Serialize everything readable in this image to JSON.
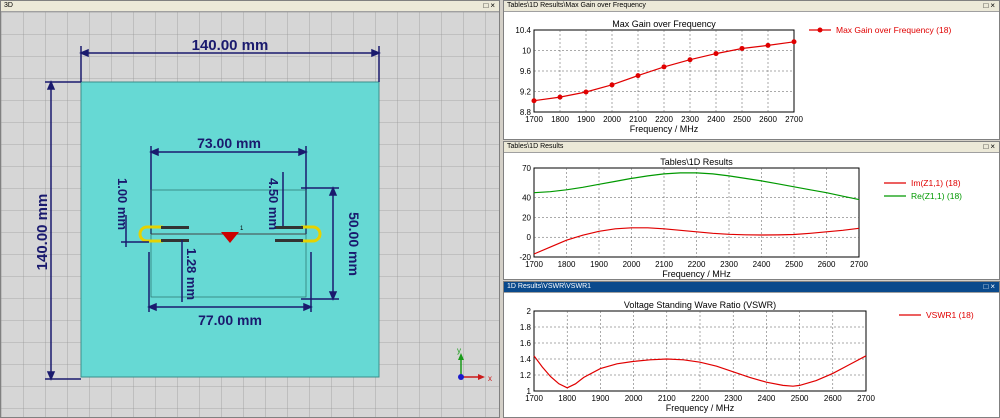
{
  "view3d": {
    "title": "3D",
    "dims": {
      "board_width": "140.00 mm",
      "board_height": "140.00 mm",
      "inner_width_top": "73.00 mm",
      "inner_width_bottom": "77.00 mm",
      "inner_height": "50.00 mm",
      "gap_left": "1.00 mm",
      "gap_right": "4.50 mm",
      "feed_gap": "1.28 mm"
    },
    "port_label": "1",
    "axes": {
      "x": "x",
      "y": "y"
    },
    "colors": {
      "substrate": "#66d9d4",
      "grid_bg": "#d8d8d8",
      "dim_line": "#1a1a6e",
      "port": "#cc0000",
      "arm": "#e6d200"
    }
  },
  "chart_data": [
    {
      "type": "line",
      "panel_title": "Tables\\1D Results\\Max Gain over Frequency",
      "title": "Max Gain over Frequency",
      "xlabel": "Frequency / MHz",
      "ylabel": "",
      "xlim": [
        1700,
        2700
      ],
      "ylim": [
        8.8,
        10.4
      ],
      "xticks": [
        1700,
        1800,
        1900,
        2000,
        2100,
        2200,
        2300,
        2400,
        2500,
        2600,
        2700
      ],
      "yticks": [
        8.8,
        9.2,
        9.6,
        10,
        10.4
      ],
      "yticklabels": [
        "8.8",
        "9.2",
        "9.6",
        "10",
        "10.4"
      ],
      "grid": true,
      "legend": "right",
      "series": [
        {
          "name": "Max Gain over Frequency (18)",
          "color": "#e00000",
          "markers": true,
          "x": [
            1700,
            1800,
            1900,
            2000,
            2100,
            2200,
            2300,
            2400,
            2500,
            2600,
            2700
          ],
          "y": [
            9.02,
            9.09,
            9.19,
            9.33,
            9.51,
            9.68,
            9.82,
            9.94,
            10.04,
            10.1,
            10.17
          ]
        }
      ]
    },
    {
      "type": "line",
      "panel_title": "Tables\\1D Results",
      "title": "Tables\\1D Results",
      "xlabel": "Frequency / MHz",
      "ylabel": "",
      "xlim": [
        1700,
        2700
      ],
      "ylim": [
        -20,
        70
      ],
      "xticks": [
        1700,
        1800,
        1900,
        2000,
        2100,
        2200,
        2300,
        2400,
        2500,
        2600,
        2700
      ],
      "yticks": [
        -20,
        0,
        20,
        40,
        70
      ],
      "yticklabels": [
        "-20",
        "0",
        "20",
        "40",
        "70"
      ],
      "grid": true,
      "legend": "right",
      "series": [
        {
          "name": "Im(Z1,1) (18)",
          "color": "#e00000",
          "markers": false,
          "x": [
            1700,
            1750,
            1800,
            1850,
            1900,
            1950,
            2000,
            2050,
            2100,
            2150,
            2200,
            2250,
            2300,
            2350,
            2400,
            2450,
            2500,
            2550,
            2600,
            2650,
            2700
          ],
          "y": [
            -17,
            -10,
            -3,
            2,
            6,
            8.5,
            9.5,
            9.5,
            8.5,
            7,
            5.5,
            4,
            3,
            2.5,
            2.2,
            2.3,
            2.8,
            4,
            5.5,
            7,
            9
          ]
        },
        {
          "name": "Re(Z1,1) (18)",
          "color": "#009900",
          "markers": false,
          "x": [
            1700,
            1750,
            1800,
            1850,
            1900,
            1950,
            2000,
            2050,
            2100,
            2150,
            2200,
            2250,
            2300,
            2350,
            2400,
            2450,
            2500,
            2550,
            2600,
            2650,
            2700
          ],
          "y": [
            45,
            46,
            48,
            50.5,
            53.5,
            56.5,
            59.5,
            62,
            64,
            65,
            65,
            64,
            62,
            59.5,
            57,
            54,
            51,
            48,
            45,
            41.5,
            38
          ]
        }
      ]
    },
    {
      "type": "line",
      "panel_title": "1D Results\\VSWR\\VSWR1",
      "title": "Voltage Standing Wave Ratio (VSWR)",
      "xlabel": "Frequency / MHz",
      "ylabel": "",
      "xlim": [
        1700,
        2700
      ],
      "ylim": [
        1,
        2
      ],
      "xticks": [
        1700,
        1800,
        1900,
        2000,
        2100,
        2200,
        2300,
        2400,
        2500,
        2600,
        2700
      ],
      "yticks": [
        1,
        1.2,
        1.4,
        1.6,
        1.8,
        2
      ],
      "yticklabels": [
        "1",
        "1.2",
        "1.4",
        "1.6",
        "1.8",
        "2"
      ],
      "grid": true,
      "legend": "right",
      "series": [
        {
          "name": "VSWR1 (18)",
          "color": "#e00000",
          "markers": false,
          "x": [
            1700,
            1725,
            1750,
            1775,
            1800,
            1825,
            1850,
            1900,
            1950,
            2000,
            2050,
            2100,
            2150,
            2200,
            2250,
            2300,
            2350,
            2400,
            2450,
            2480,
            2500,
            2550,
            2600,
            2650,
            2700
          ],
          "y": [
            1.44,
            1.3,
            1.18,
            1.09,
            1.04,
            1.09,
            1.17,
            1.28,
            1.34,
            1.37,
            1.39,
            1.4,
            1.39,
            1.36,
            1.31,
            1.24,
            1.17,
            1.11,
            1.07,
            1.06,
            1.07,
            1.13,
            1.22,
            1.33,
            1.44
          ]
        }
      ]
    }
  ]
}
